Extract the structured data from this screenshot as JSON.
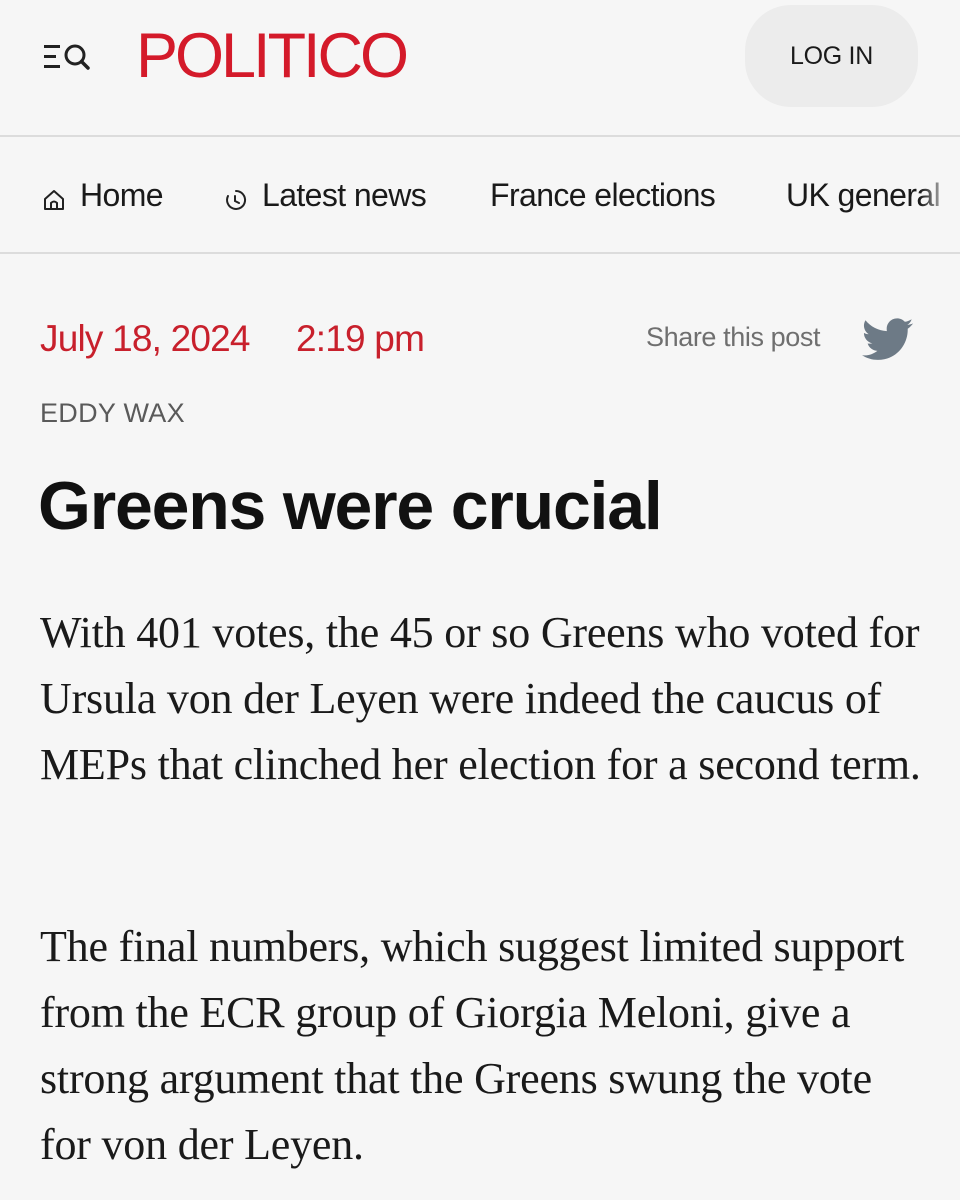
{
  "header": {
    "logo_text": "POLITICO",
    "login_label": "LOG IN",
    "menu_icon": "menu-search-icon"
  },
  "nav": {
    "items": [
      {
        "label": "Home",
        "icon": "home-icon"
      },
      {
        "label": "Latest news",
        "icon": "clock-icon"
      },
      {
        "label": "France elections"
      },
      {
        "label": "UK general"
      }
    ]
  },
  "article": {
    "date": "July 18, 2024",
    "time": "2:19 pm",
    "share_label": "Share this post",
    "share_icon": "twitter-icon",
    "author": "EDDY WAX",
    "headline": "Greens were crucial",
    "paragraphs": [
      "With 401 votes, the 45 or so Greens who voted for Ursula von der Leyen were indeed the caucus of MEPs that clinched her election for a second term.",
      "The final numbers, which suggest limited support from the ECR group of Giorgia Meloni, give a strong argument that the Greens swung the vote for von der Leyen."
    ]
  },
  "colors": {
    "brand": "#d41a2a",
    "date": "#c8202c",
    "background": "#f6f6f6"
  }
}
